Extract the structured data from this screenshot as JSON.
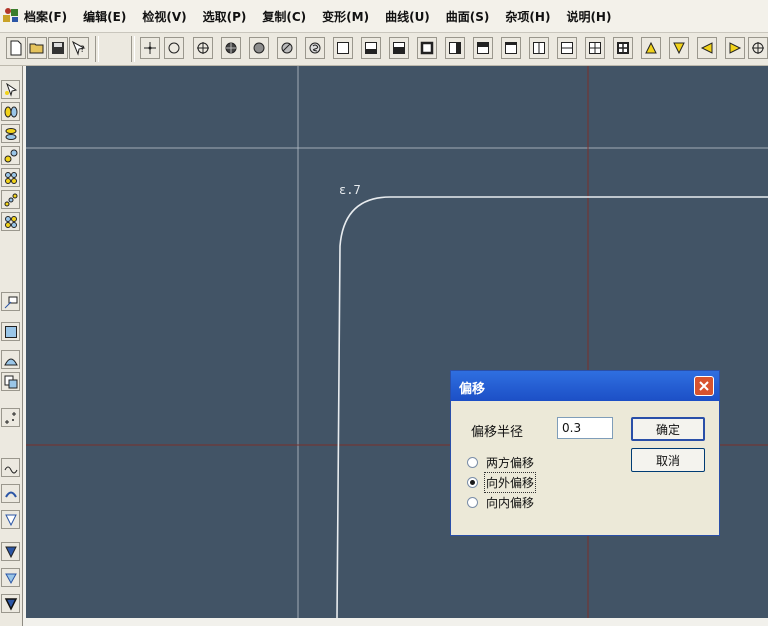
{
  "menubar": {
    "items": [
      "档案(F)",
      "编辑(E)",
      "检视(V)",
      "选取(P)",
      "复制(C)",
      "变形(M)",
      "曲线(U)",
      "曲面(S)",
      "杂项(H)",
      "说明(H)"
    ]
  },
  "toolbar": {
    "icons": [
      "new-file-icon",
      "open-folder-icon",
      "save-disk-icon",
      "help-pointer-icon",
      "point-icon",
      "circle-icon",
      "crosshair-circle-icon",
      "filled-circle-icon",
      "gray-disk-icon",
      "hatched-circle-icon",
      "s-circle-icon",
      "rectangle-icon",
      "rect-bottom-icon",
      "rect-bottom-bold-icon",
      "rect-bold-icon",
      "rect-left-bold-icon",
      "rect-top-bold-icon",
      "rect-top-icon",
      "rect-vsplit-icon",
      "rect-hsplit-icon",
      "rect-grid-icon",
      "rect-grid-bold-icon",
      "triangle-up-icon",
      "triangle-down-icon",
      "triangle-left-icon",
      "triangle-right-icon",
      "crosshair-icon"
    ]
  },
  "colors": {
    "viewport": "#425466",
    "grid_light": "#b9c3cc",
    "grid_red": "#7a2f2a",
    "curve": "#e8ecef",
    "title_bar": "#2f6fe0"
  },
  "viewport": {
    "curve_label": "ε.7"
  },
  "dialog": {
    "title": "偏移",
    "radius_label": "偏移半径",
    "radius_value": "0.3",
    "ok_label": "确定",
    "cancel_label": "取消",
    "options": [
      {
        "label": "两方偏移",
        "selected": false
      },
      {
        "label": "向外偏移",
        "selected": true
      },
      {
        "label": "向内偏移",
        "selected": false
      }
    ]
  }
}
